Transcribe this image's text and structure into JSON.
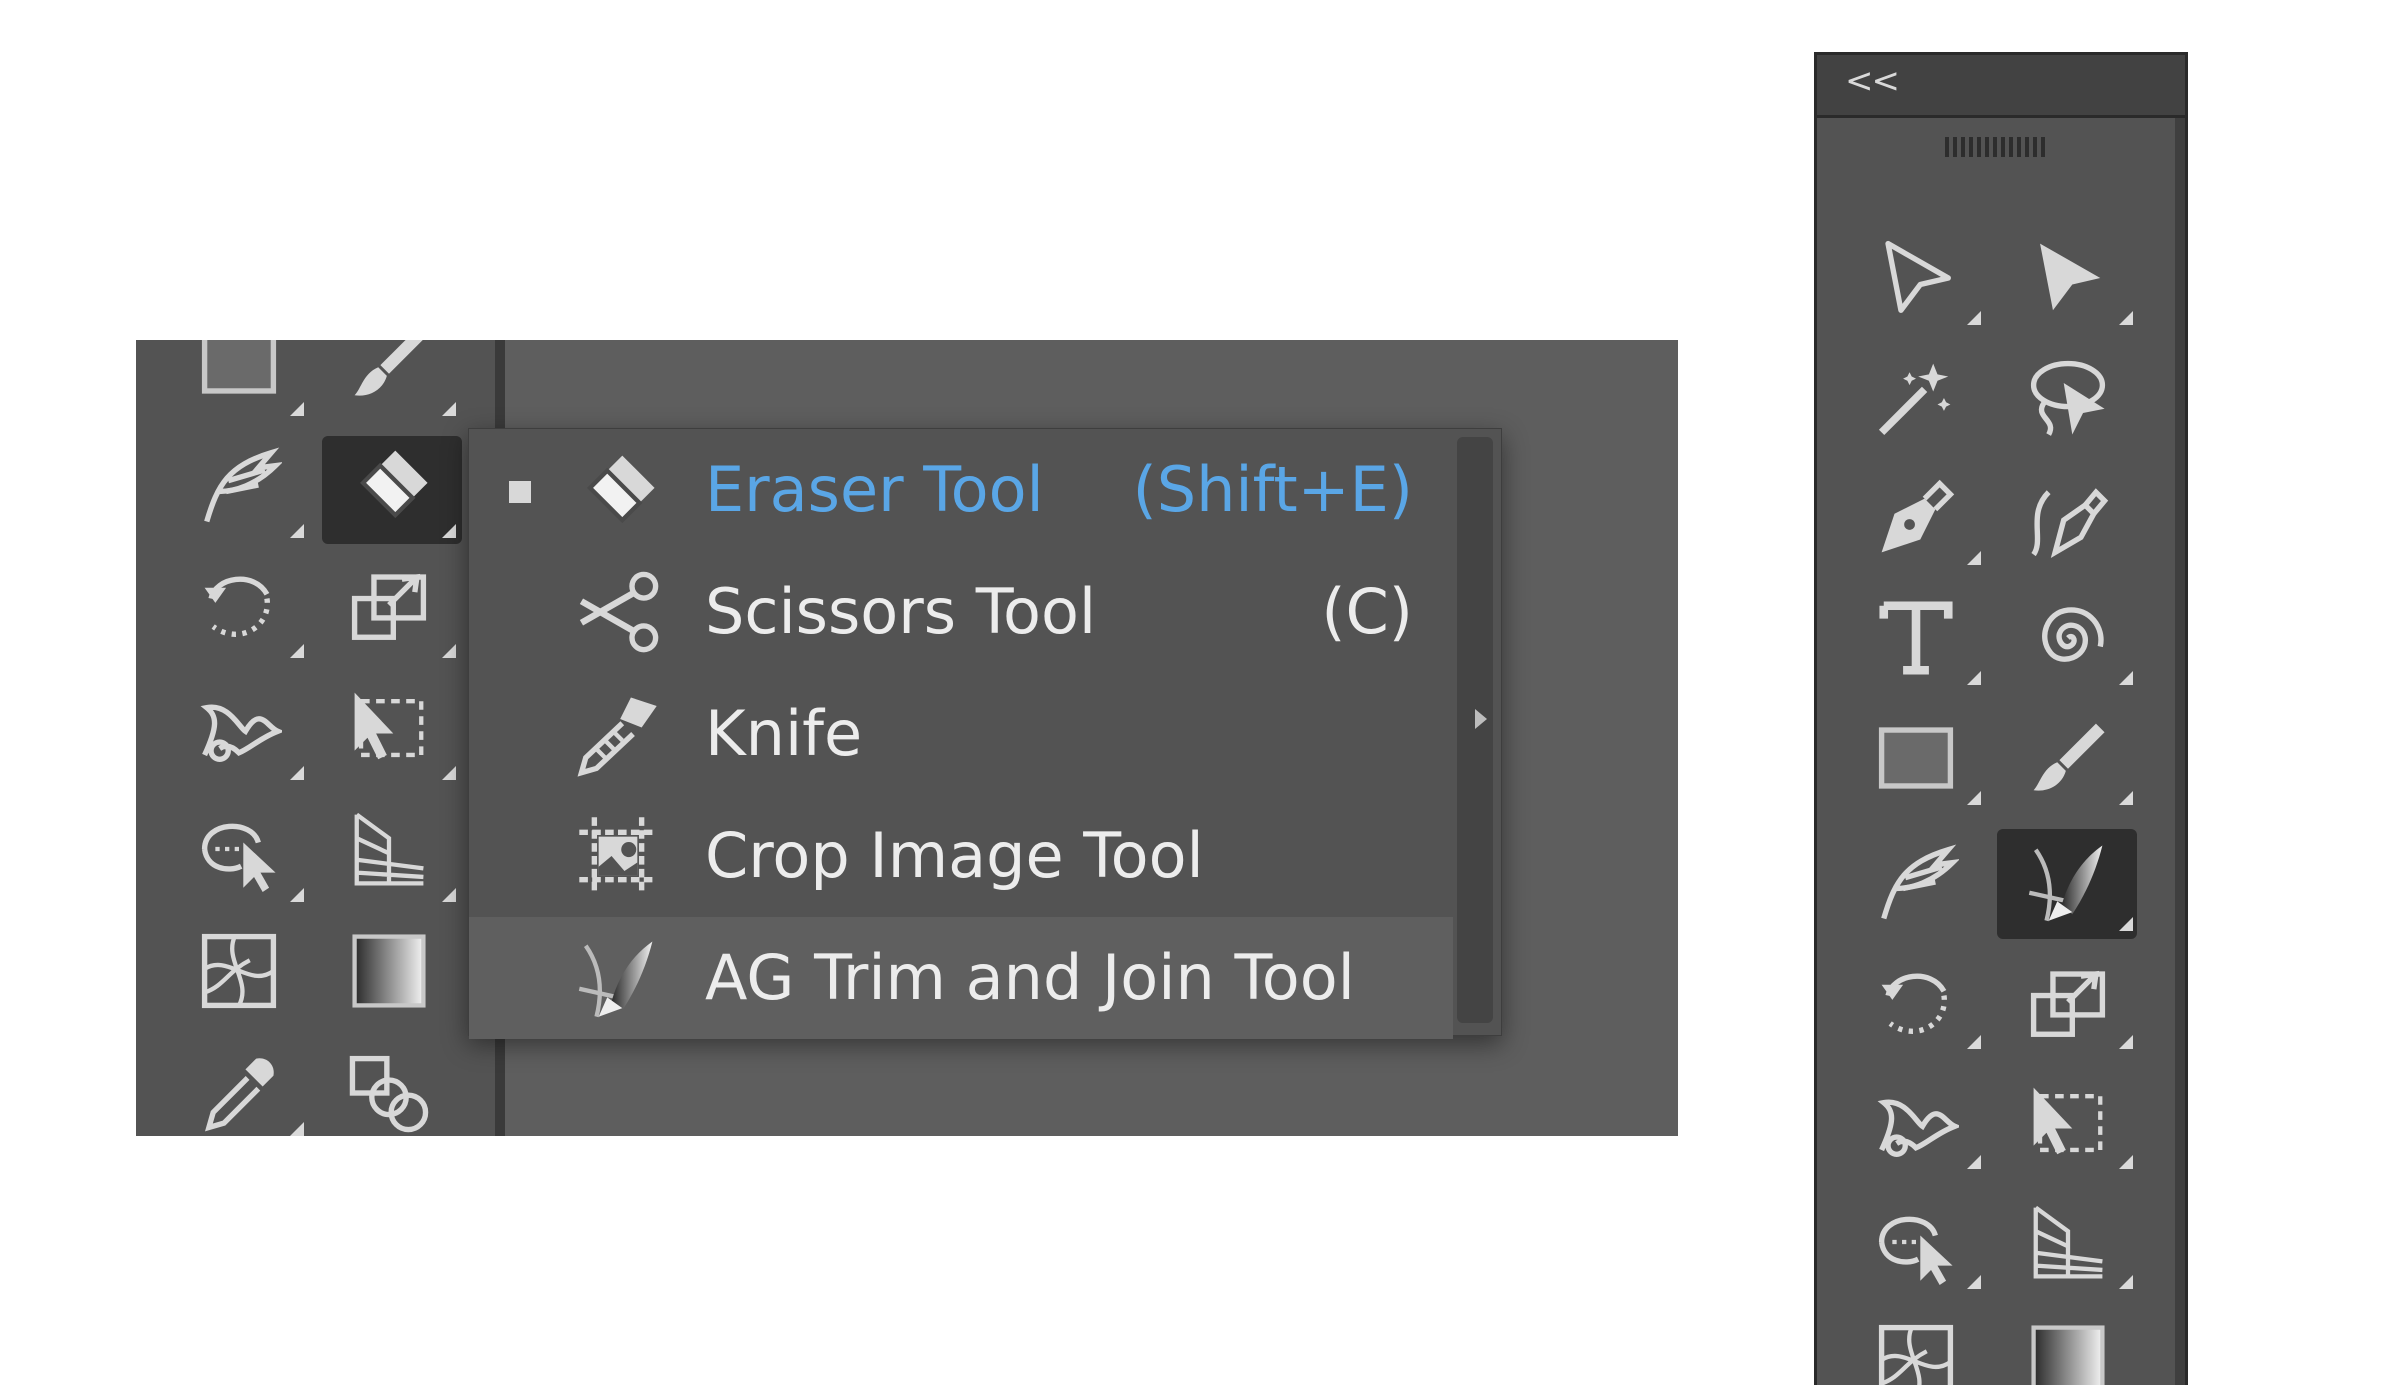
{
  "flyout": {
    "items": [
      {
        "label": "Eraser Tool",
        "shortcut": "(Shift+E)",
        "icon": "eraser-icon",
        "selected": true
      },
      {
        "label": "Scissors Tool",
        "shortcut": "(C)",
        "icon": "scissors-icon"
      },
      {
        "label": "Knife",
        "shortcut": "",
        "icon": "knife-icon"
      },
      {
        "label": "Crop Image Tool",
        "shortcut": "",
        "icon": "crop-image-icon"
      },
      {
        "label": "AG Trim and Join Tool",
        "shortcut": "",
        "icon": "trim-join-icon",
        "highlighted": true
      }
    ]
  },
  "right_panel": {
    "collapse_label": "<<",
    "tools": [
      "selection-tool",
      "direct-selection-tool",
      "magic-wand-tool",
      "lasso-tool",
      "pen-tool",
      "curvature-tool",
      "type-tool",
      "spiral-tool",
      "rectangle-tool",
      "paintbrush-tool",
      "shaper-tool",
      "ag-trim-join-tool",
      "rotate-tool",
      "scale-tool",
      "warp-tool",
      "free-transform-tool",
      "shape-builder-tool",
      "perspective-grid-tool",
      "mesh-tool",
      "gradient-tool"
    ]
  },
  "left_panel": {
    "tools": [
      "rectangle-tool",
      "paintbrush-tool",
      "shaper-tool",
      "eraser-tool",
      "rotate-tool",
      "scale-tool",
      "warp-tool",
      "free-transform-tool",
      "shape-builder-tool",
      "perspective-grid-tool",
      "mesh-tool",
      "gradient-tool",
      "eyedropper-tool",
      "blend-tool"
    ]
  },
  "colors": {
    "accent": "#5aa6e6",
    "panel": "#535353",
    "canvas": "#5e5e5e",
    "active_tool_bg": "#2e2e2e"
  }
}
